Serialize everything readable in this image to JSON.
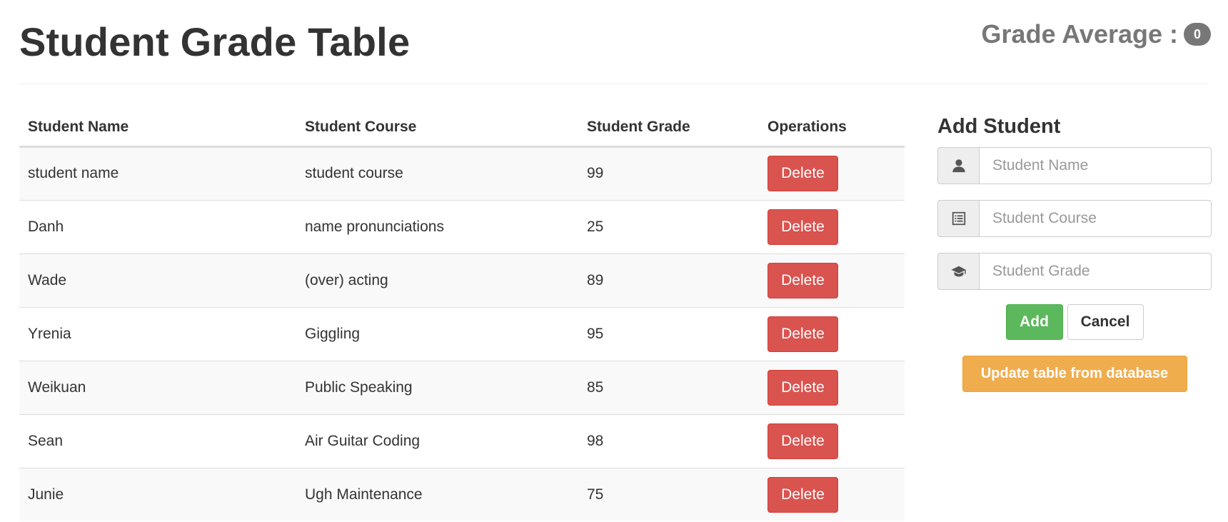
{
  "header": {
    "title": "Student Grade Table",
    "grade_average_label": "Grade Average :",
    "grade_average_value": "0"
  },
  "table": {
    "columns": [
      "Student Name",
      "Student Course",
      "Student Grade",
      "Operations"
    ],
    "delete_label": "Delete",
    "rows": [
      {
        "name": "student name",
        "course": "student course",
        "grade": "99"
      },
      {
        "name": "Danh",
        "course": "name pronunciations",
        "grade": "25"
      },
      {
        "name": "Wade",
        "course": "(over) acting",
        "grade": "89"
      },
      {
        "name": "Yrenia",
        "course": "Giggling",
        "grade": "95"
      },
      {
        "name": "Weikuan",
        "course": "Public Speaking",
        "grade": "85"
      },
      {
        "name": "Sean",
        "course": "Air Guitar Coding",
        "grade": "98"
      },
      {
        "name": "Junie",
        "course": "Ugh Maintenance",
        "grade": "75"
      }
    ]
  },
  "form": {
    "title": "Add Student",
    "fields": [
      {
        "placeholder": "Student Name",
        "icon": "user-icon",
        "value": ""
      },
      {
        "placeholder": "Student Course",
        "icon": "list-alt-icon",
        "value": ""
      },
      {
        "placeholder": "Student Grade",
        "icon": "graduation-cap-icon",
        "value": ""
      }
    ],
    "add_label": "Add",
    "cancel_label": "Cancel",
    "update_label": "Update table from database"
  },
  "colors": {
    "delete": "#d9534f",
    "add": "#5cb85c",
    "update": "#f0ad4e",
    "badge": "#777777"
  }
}
